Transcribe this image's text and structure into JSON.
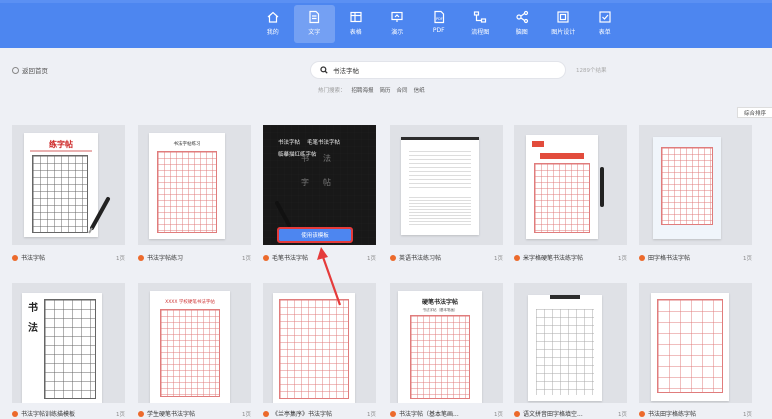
{
  "nav": [
    {
      "label": "我的",
      "icon": "home-icon",
      "active": false
    },
    {
      "label": "文字",
      "icon": "document-icon",
      "active": true
    },
    {
      "label": "表格",
      "icon": "table-icon",
      "active": false
    },
    {
      "label": "演示",
      "icon": "presentation-icon",
      "active": false
    },
    {
      "label": "PDF",
      "icon": "pdf-icon",
      "active": false
    },
    {
      "label": "流程图",
      "icon": "flowchart-icon",
      "active": false
    },
    {
      "label": "脑图",
      "icon": "mindmap-icon",
      "active": false
    },
    {
      "label": "图片设计",
      "icon": "image-design-icon",
      "active": false
    },
    {
      "label": "表单",
      "icon": "form-icon",
      "active": false
    }
  ],
  "back_label": "返回首页",
  "search": {
    "value": "书法字帖",
    "placeholder": ""
  },
  "result_count": "1289个结果",
  "hot_search": {
    "label": "热门搜索：",
    "keywords": [
      "招聘海报",
      "简历",
      "合同",
      "信纸"
    ]
  },
  "sort_label": "综合排序",
  "hover_button_label": "使用该模板",
  "cards": [
    {
      "name": "书法字帖",
      "pages": "1页"
    },
    {
      "name": "书法字帖练习",
      "pages": "1页"
    },
    {
      "name": "毛笔书法字帖",
      "pages": "1页"
    },
    {
      "name": "英语书法练习帖",
      "pages": "1页"
    },
    {
      "name": "米字格硬笔书法练字帖",
      "pages": "1页"
    },
    {
      "name": "田字格书法字帖",
      "pages": "1页"
    },
    {
      "name": "书法字帖训练描模板",
      "pages": "1页"
    },
    {
      "name": "学生硬笔书法字帖",
      "pages": "1页"
    },
    {
      "name": "《兰亭集序》书法字帖",
      "pages": "1页"
    },
    {
      "name": "书法字帖（基本笔画...",
      "pages": "1页"
    },
    {
      "name": "语文拼音田字格填空...",
      "pages": "1页"
    },
    {
      "name": "书法田字格练字帖",
      "pages": "1页"
    }
  ],
  "thumb_text": {
    "c1_title": "练字帖",
    "c2_title": "书法字帖练习",
    "c3_words": [
      "书法字帖",
      "毛笔书法字帖",
      "临摹描红练字帖"
    ],
    "c3_big": [
      "书",
      "法",
      "字",
      "帖"
    ],
    "c8_title": "XXXX 学校硬笔书法字帖",
    "c10_title": "硬笔书法字帖",
    "c10_sub": "书法字帖（基本笔画）",
    "c7_big": [
      "书",
      "法"
    ]
  }
}
